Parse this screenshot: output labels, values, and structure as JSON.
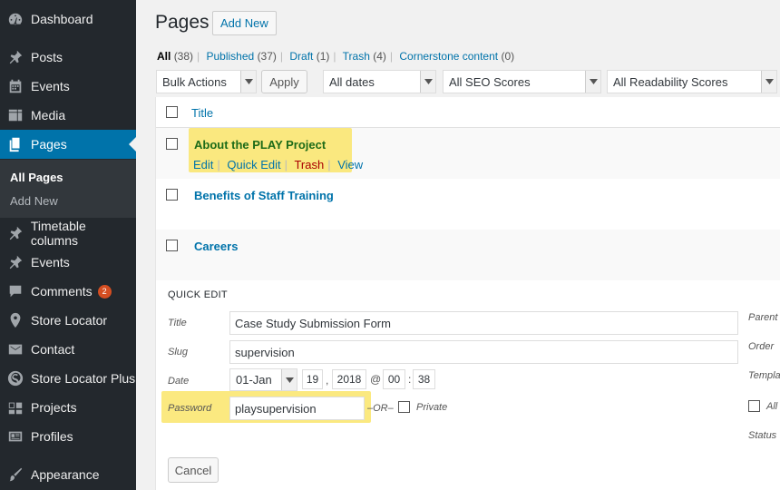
{
  "sidebar": {
    "items": [
      {
        "label": "Dashboard",
        "icon": "dashboard-icon"
      },
      {
        "label": "Posts",
        "icon": "pin-icon"
      },
      {
        "label": "Events",
        "icon": "calendar-icon"
      },
      {
        "label": "Media",
        "icon": "media-icon"
      },
      {
        "label": "Pages",
        "icon": "pages-icon"
      },
      {
        "label": "Timetable columns",
        "icon": "pin-icon"
      },
      {
        "label": "Events",
        "icon": "pin-icon"
      },
      {
        "label": "Comments",
        "icon": "comment-icon",
        "badge": "2"
      },
      {
        "label": "Store Locator",
        "icon": "location-icon"
      },
      {
        "label": "Contact",
        "icon": "mail-icon"
      },
      {
        "label": "Store Locator Plus",
        "icon": "slp-icon"
      },
      {
        "label": "Projects",
        "icon": "projects-icon"
      },
      {
        "label": "Profiles",
        "icon": "profile-icon"
      },
      {
        "label": "Appearance",
        "icon": "brush-icon"
      }
    ],
    "submenu": [
      "All Pages",
      "Add New"
    ]
  },
  "header": {
    "title": "Pages",
    "add_new": "Add New"
  },
  "filters": [
    {
      "label": "All",
      "count": "(38)"
    },
    {
      "label": "Published",
      "count": "(37)"
    },
    {
      "label": "Draft",
      "count": "(1)"
    },
    {
      "label": "Trash",
      "count": "(4)"
    },
    {
      "label": "Cornerstone content",
      "count": "(0)"
    }
  ],
  "tablenav": {
    "bulk_actions": "Bulk Actions",
    "apply": "Apply",
    "dates": "All dates",
    "seo": "All SEO Scores",
    "readability": "All Readability Scores"
  },
  "table": {
    "title_header": "Title",
    "rows": [
      {
        "title": "About the PLAY Project",
        "actions": [
          "Edit",
          "Quick Edit",
          "Trash",
          "View"
        ]
      },
      {
        "title": "Benefits of Staff Training"
      },
      {
        "title": "Careers"
      }
    ]
  },
  "quick_edit": {
    "heading": "QUICK EDIT",
    "title_label": "Title",
    "title_value": "Case Study Submission Form",
    "slug_label": "Slug",
    "slug_value": "supervision",
    "date_label": "Date",
    "date_month": "01-Jan",
    "date_day": "19",
    "date_year": "2018",
    "date_hour": "00",
    "date_min": "38",
    "comma": ",",
    "at": "@",
    "colon": ":",
    "password_label": "Password",
    "password_value": "playsupervision",
    "or": "–OR–",
    "private": "Private",
    "cancel": "Cancel",
    "right_labels": [
      "Parent",
      "Order",
      "Templa",
      "All",
      "Status"
    ]
  },
  "colors": {
    "sidebar_bg": "#23282d",
    "active": "#0073aa",
    "highlight": "#f9e256",
    "badge": "#d54e21"
  }
}
